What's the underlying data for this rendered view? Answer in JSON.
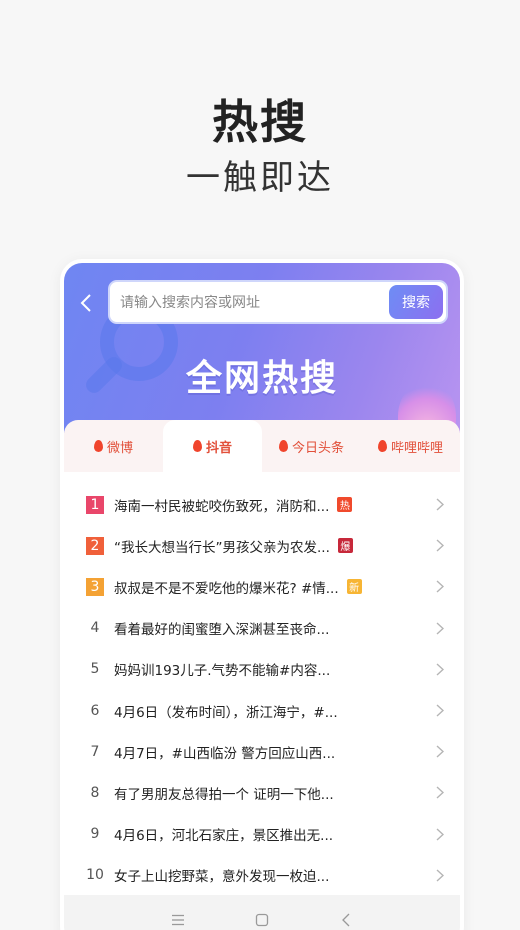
{
  "hero": {
    "title": "热搜",
    "subtitle": "一触即达"
  },
  "search": {
    "placeholder": "请输入搜索内容或网址",
    "button_label": "搜索"
  },
  "banner": {
    "title": "全网热搜"
  },
  "tabs": [
    {
      "label": "微博",
      "active": false
    },
    {
      "label": "抖音",
      "active": true
    },
    {
      "label": "今日头条",
      "active": false
    },
    {
      "label": "哔哩哔哩",
      "active": false
    }
  ],
  "list": [
    {
      "rank": "1",
      "title": "海南一村民被蛇咬伤致死，消防和...",
      "badge": "热"
    },
    {
      "rank": "2",
      "title": "“我长大想当行长”男孩父亲为农发...",
      "badge": "爆"
    },
    {
      "rank": "3",
      "title": "叔叔是不是不爱吃他的爆米花? #情...",
      "badge": "新"
    },
    {
      "rank": "4",
      "title": "看着最好的闺蜜堕入深渊甚至丧命...",
      "badge": ""
    },
    {
      "rank": "5",
      "title": "妈妈训193儿子.气势不能输#内容...",
      "badge": ""
    },
    {
      "rank": "6",
      "title": "4月6日（发布时间），浙江海宁，#...",
      "badge": ""
    },
    {
      "rank": "7",
      "title": "4月7日，#山西临汾 警方回应山西...",
      "badge": ""
    },
    {
      "rank": "8",
      "title": "有了男朋友总得拍一个 证明一下他...",
      "badge": ""
    },
    {
      "rank": "9",
      "title": "4月6日，河北石家庄，景区推出无...",
      "badge": ""
    },
    {
      "rank": "10",
      "title": "女子上山挖野菜，意外发现一枚迫...",
      "badge": ""
    }
  ],
  "icons": {
    "back": "chevron-left-icon",
    "row_arrow": "chevron-right-icon",
    "fire": "fire-icon",
    "nav": [
      "menu-icon",
      "home-icon",
      "back-icon"
    ]
  },
  "colors": {
    "accent": "#e2503a",
    "rank1": "#e9466a",
    "rank2": "#f0603a",
    "rank3": "#f4a234",
    "banner_start": "#6f86f2",
    "banner_end": "#b894f0"
  }
}
